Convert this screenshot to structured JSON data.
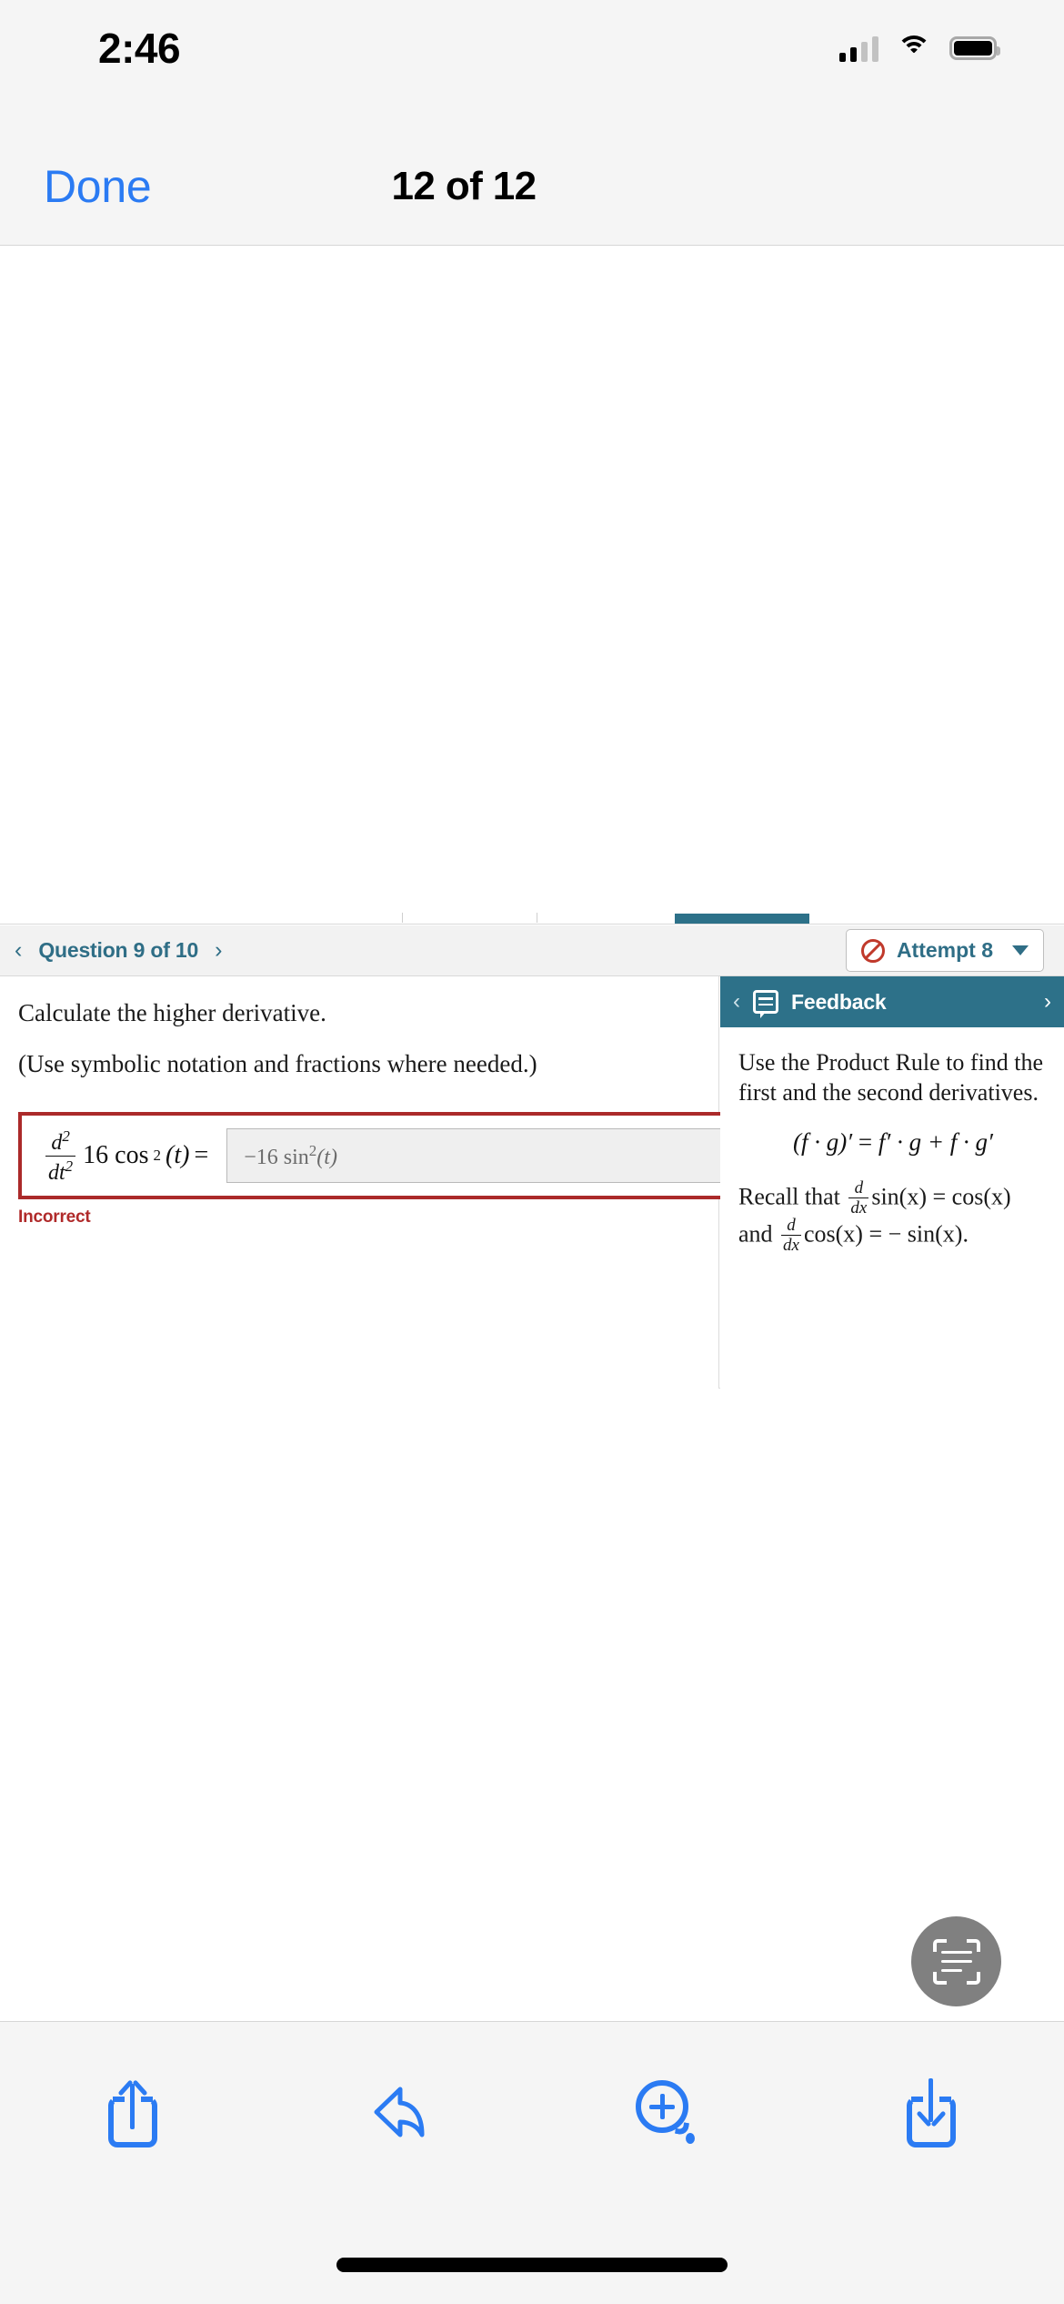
{
  "status_bar": {
    "time": "2:46",
    "cellular_icon": "signal-bars-icon",
    "wifi_icon": "wifi-icon",
    "battery_icon": "battery-full-icon"
  },
  "nav_bar": {
    "done_label": "Done",
    "title": "12 of 12"
  },
  "document": {
    "question_nav": {
      "prev_icon": "chevron-left-icon",
      "next_icon": "chevron-right-icon",
      "label": "Question 9 of 10"
    },
    "attempt": {
      "status_icon": "no-entry-icon",
      "label": "Attempt 8",
      "caret_icon": "chevron-down-icon"
    },
    "question": {
      "prompt": "Calculate the higher derivative.",
      "instruction": "(Use symbolic notation and fractions where needed.)",
      "expression": {
        "frac_num": "d",
        "frac_num_sup": "2",
        "frac_den": "dt",
        "frac_den_sup": "2",
        "body": "16 cos",
        "body_sup": "2",
        "body_arg": "(t)",
        "equals": "="
      },
      "answer_value": "−16 sin² (t)",
      "answer_parts": {
        "coefficient": "−16 sin",
        "exponent": "2",
        "argument": "(t)"
      },
      "result_status": "Incorrect"
    },
    "feedback": {
      "back_icon": "chevron-left-icon",
      "panel_icon": "feedback-bubble-icon",
      "title": "Feedback",
      "forward_icon": "chevron-right-icon",
      "paragraph_1": "Use the Product Rule to find the first and the second derivatives.",
      "formula": {
        "lhs": "(f · g)′",
        "equals": "=",
        "rhs": "f′ · g + f · g′"
      },
      "paragraph_2_pre": "Recall that",
      "paragraph_2_frac_num": "d",
      "paragraph_2_frac_den": "dx",
      "paragraph_2_mid": "sin(x) = cos(x) and",
      "paragraph_2_frac2_num": "d",
      "paragraph_2_frac2_den": "dx",
      "paragraph_2_end": "cos(x) = − sin(x)."
    }
  },
  "floating_button": {
    "icon": "live-text-scan-icon"
  },
  "bottom_toolbar": {
    "items": [
      {
        "icon": "share-icon"
      },
      {
        "icon": "reply-arrow-icon"
      },
      {
        "icon": "markup-add-icon"
      },
      {
        "icon": "download-icon"
      }
    ]
  },
  "home_indicator": {
    "icon": "home-indicator"
  },
  "colors": {
    "accent_blue": "#2b7bf3",
    "teal": "#2d7189",
    "error_red": "#ab2a2a",
    "chrome_gray": "#f5f5f5",
    "fab_gray": "#808080"
  }
}
